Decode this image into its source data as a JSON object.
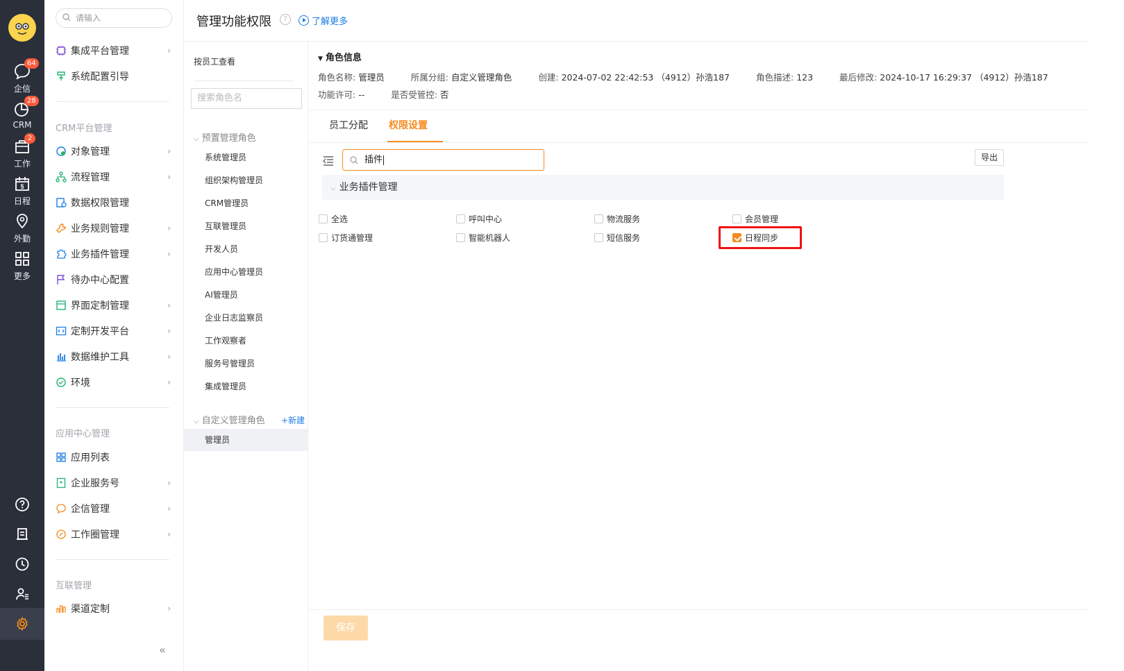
{
  "rail": {
    "items": [
      {
        "label": "企信",
        "badge": "64",
        "icon": "chat-icon"
      },
      {
        "label": "CRM",
        "badge": "28",
        "icon": "chart-pie-icon"
      },
      {
        "label": "工作",
        "badge": "2",
        "icon": "briefcase-icon"
      },
      {
        "label": "日程",
        "badge": "",
        "icon": "calendar-icon",
        "day": "5"
      },
      {
        "label": "外勤",
        "badge": "",
        "icon": "location-pin-icon"
      },
      {
        "label": "更多",
        "badge": "",
        "icon": "grid-icon"
      }
    ],
    "bottom_icons": [
      "help-icon",
      "notepad-icon",
      "clock-icon",
      "user-list-icon",
      "settings-icon"
    ]
  },
  "menu": {
    "search_placeholder": "请输入",
    "top_items": [
      {
        "label": "集成平台管理",
        "icon": "chip-icon",
        "has_children": true
      },
      {
        "label": "系统配置引导",
        "icon": "guide-icon",
        "has_children": false
      }
    ],
    "group_crm": "CRM平台管理",
    "crm_items": [
      {
        "label": "对象管理",
        "icon": "cube-icon",
        "has_children": true
      },
      {
        "label": "流程管理",
        "icon": "flow-icon",
        "has_children": true
      },
      {
        "label": "数据权限管理",
        "icon": "data-lock-icon",
        "has_children": false
      },
      {
        "label": "业务规则管理",
        "icon": "wrench-icon",
        "has_children": true
      },
      {
        "label": "业务插件管理",
        "icon": "puzzle-icon",
        "has_children": true
      },
      {
        "label": "待办中心配置",
        "icon": "flag-icon",
        "has_children": false
      },
      {
        "label": "界面定制管理",
        "icon": "layout-icon",
        "has_children": true
      },
      {
        "label": "定制开发平台",
        "icon": "code-icon",
        "has_children": true
      },
      {
        "label": "数据维护工具",
        "icon": "bar-chart-icon",
        "has_children": true
      },
      {
        "label": "环境",
        "icon": "environment-icon",
        "has_children": true
      }
    ],
    "group_app": "应用中心管理",
    "app_items": [
      {
        "label": "应用列表",
        "icon": "app-grid-icon",
        "has_children": false
      },
      {
        "label": "企业服务号",
        "icon": "service-icon",
        "has_children": true
      },
      {
        "label": "企信管理",
        "icon": "message-icon",
        "has_children": true
      },
      {
        "label": "工作圈管理",
        "icon": "circle-edit-icon",
        "has_children": true
      }
    ],
    "group_interconnect": "互联管理",
    "interconnect_items": [
      {
        "label": "渠道定制",
        "icon": "channel-icon",
        "has_children": true
      }
    ]
  },
  "header": {
    "title": "管理功能权限",
    "learn_more": "了解更多"
  },
  "roles": {
    "by_employee": "按员工查看",
    "search_placeholder": "搜索角色名",
    "preset_group": "预置管理角色",
    "preset_items": [
      "系统管理员",
      "组织架构管理员",
      "CRM管理员",
      "互联管理员",
      "开发人员",
      "应用中心管理员",
      "AI管理员",
      "企业日志监察员",
      "工作观察者",
      "服务号管理员",
      "集成管理员"
    ],
    "custom_group": "自定义管理角色",
    "new_label": "+新建",
    "custom_items": [
      "管理员"
    ]
  },
  "role_info": {
    "title": "角色信息",
    "name_label": "角色名称:",
    "name_value": "管理员",
    "group_label": "所属分组:",
    "group_value": "自定义管理角色",
    "created_label": "创建:",
    "created_value": "2024-07-02 22:42:53 （4912）孙浩187",
    "desc_label": "角色描述:",
    "desc_value": "123",
    "modified_label": "最后修改:",
    "modified_value": "2024-10-17 16:29:37 （4912）孙浩187",
    "license_label": "功能许可:",
    "license_value": "--",
    "controlled_label": "是否受管控:",
    "controlled_value": "否"
  },
  "tabs": [
    {
      "label": "员工分配",
      "active": false
    },
    {
      "label": "权限设置",
      "active": true
    }
  ],
  "permissions": {
    "search_value": "插件",
    "export_label": "导出",
    "section_title": "业务插件管理",
    "checkboxes": [
      {
        "label": "全选",
        "checked": false
      },
      {
        "label": "呼叫中心",
        "checked": false
      },
      {
        "label": "物流服务",
        "checked": false
      },
      {
        "label": "会员管理",
        "checked": false
      },
      {
        "label": "订货通管理",
        "checked": false
      },
      {
        "label": "智能机器人",
        "checked": false
      },
      {
        "label": "短信服务",
        "checked": false
      },
      {
        "label": "日程同步",
        "checked": true
      }
    ],
    "save_label": "保存"
  },
  "colors": {
    "accent": "#f58c1e",
    "rail_bg": "#2a2f3a",
    "link": "#1d7ee5",
    "highlight": "#ee1111"
  }
}
